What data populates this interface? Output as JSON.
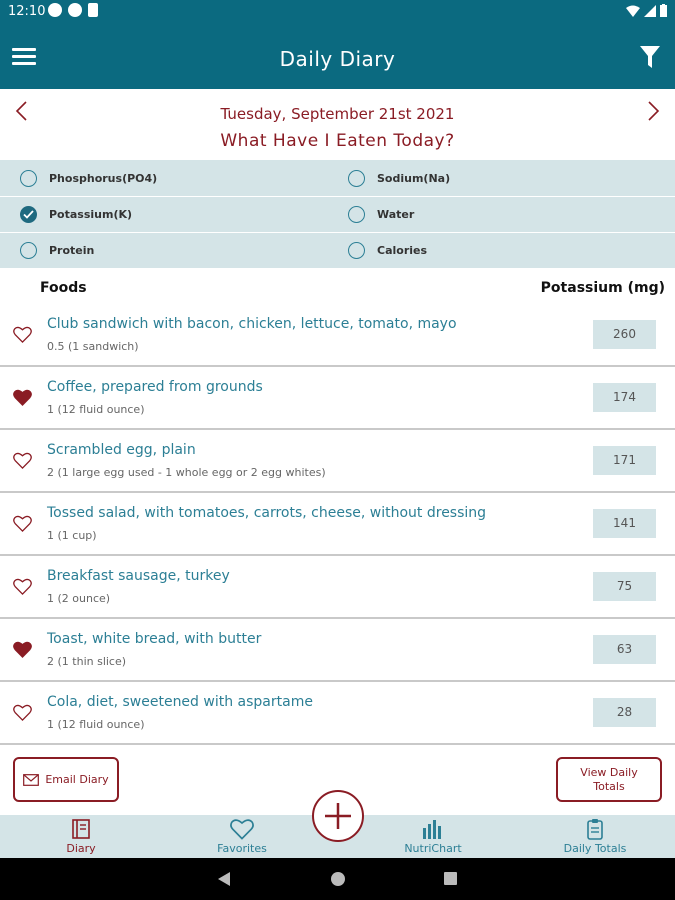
{
  "status_bar": {
    "time": "12:10"
  },
  "app_bar": {
    "title": "Daily Diary"
  },
  "date_header": {
    "date": "Tuesday, September 21st 2021",
    "question": "What Have I Eaten Today?"
  },
  "nutrient_options": [
    {
      "label": "Phosphorus(PO4)",
      "checked": false
    },
    {
      "label": "Sodium(Na)",
      "checked": false
    },
    {
      "label": "Potassium(K)",
      "checked": true
    },
    {
      "label": "Water",
      "checked": false
    },
    {
      "label": "Protein",
      "checked": false
    },
    {
      "label": "Calories",
      "checked": false
    }
  ],
  "list_header": {
    "foods": "Foods",
    "nutrient": "Potassium (mg)"
  },
  "foods": [
    {
      "name": "Club sandwich with bacon, chicken, lettuce, tomato, mayo",
      "quantity": "0.5 (1 sandwich)",
      "value": "260",
      "favorite": false
    },
    {
      "name": "Coffee, prepared from grounds",
      "quantity": "1 (12 fluid ounce)",
      "value": "174",
      "favorite": true
    },
    {
      "name": "Scrambled egg, plain",
      "quantity": "2 (1 large egg used - 1 whole egg or 2 egg whites)",
      "value": "171",
      "favorite": false
    },
    {
      "name": "Tossed salad, with tomatoes, carrots, cheese, without dressing",
      "quantity": "1 (1 cup)",
      "value": "141",
      "favorite": false
    },
    {
      "name": "Breakfast sausage, turkey",
      "quantity": "1 (2 ounce)",
      "value": "75",
      "favorite": false
    },
    {
      "name": "Toast, white bread, with butter",
      "quantity": "2 (1 thin slice)",
      "value": "63",
      "favorite": true
    },
    {
      "name": "Cola, diet, sweetened with aspartame",
      "quantity": "1 (12 fluid ounce)",
      "value": "28",
      "favorite": false
    }
  ],
  "actions": {
    "email_label": "Email Diary",
    "view_totals_label": "View Daily Totals"
  },
  "bottom_nav": [
    {
      "label": "Diary",
      "icon": "diary-icon",
      "active": true
    },
    {
      "label": "Favorites",
      "icon": "heart-icon",
      "active": false
    },
    {
      "label": "NutriChart",
      "icon": "bar-chart-icon",
      "active": false
    },
    {
      "label": "Daily Totals",
      "icon": "clipboard-icon",
      "active": false
    }
  ],
  "colors": {
    "primary": "#0b6a80",
    "accent": "#8a1c24",
    "panel": "#d4e4e7",
    "link": "#2c7f95"
  }
}
